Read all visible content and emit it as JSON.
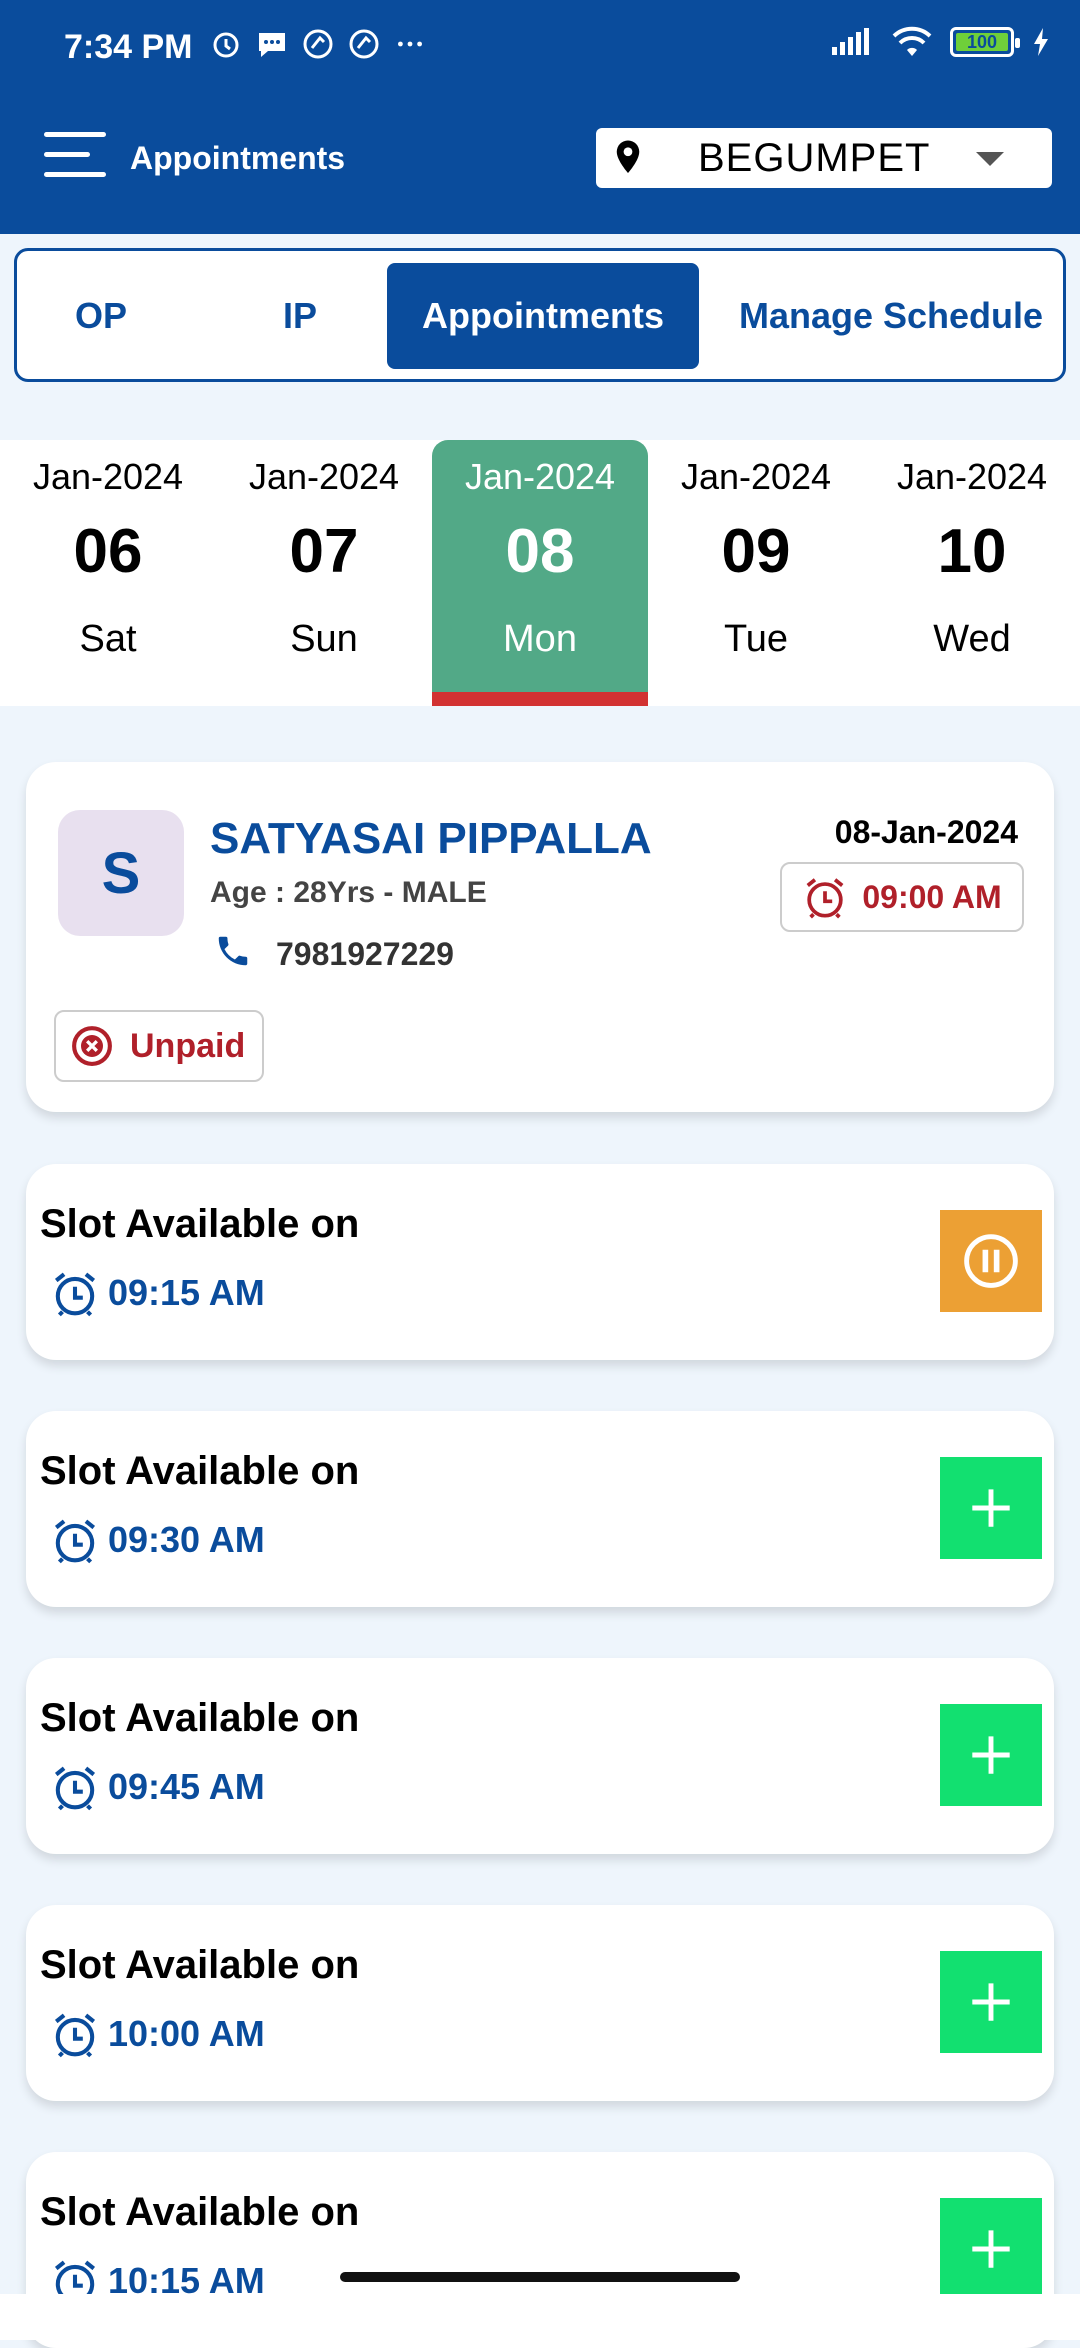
{
  "status_bar": {
    "time": "7:34 PM",
    "battery": "100"
  },
  "app_bar": {
    "title": "Appointments",
    "location": "BEGUMPET"
  },
  "tabs": [
    {
      "label": "OP"
    },
    {
      "label": "IP"
    },
    {
      "label": "Appointments",
      "active": true
    },
    {
      "label": "Manage Schedule"
    }
  ],
  "dates": [
    {
      "month": "Jan-2024",
      "day": "06",
      "weekday": "Sat"
    },
    {
      "month": "Jan-2024",
      "day": "07",
      "weekday": "Sun"
    },
    {
      "month": "Jan-2024",
      "day": "08",
      "weekday": "Mon",
      "active": true
    },
    {
      "month": "Jan-2024",
      "day": "09",
      "weekday": "Tue"
    },
    {
      "month": "Jan-2024",
      "day": "10",
      "weekday": "Wed"
    }
  ],
  "appointment": {
    "initial": "S",
    "name": "SATYASAI PIPPALLA",
    "age": "Age : 28Yrs - MALE",
    "phone": "7981927229",
    "date": "08-Jan-2024",
    "time": "09:00 AM",
    "payment_status": "Unpaid"
  },
  "slots": [
    {
      "label": "Slot Available on",
      "time": "09:15 AM",
      "action": "pause"
    },
    {
      "label": "Slot Available on",
      "time": "09:30 AM",
      "action": "add"
    },
    {
      "label": "Slot Available on",
      "time": "09:45 AM",
      "action": "add"
    },
    {
      "label": "Slot Available on",
      "time": "10:00 AM",
      "action": "add"
    },
    {
      "label": "Slot Available on",
      "time": "10:15 AM",
      "action": "add"
    }
  ],
  "colors": {
    "primary": "#0a4c9c",
    "active_date": "#52a987",
    "add_button": "#12e070",
    "pause_button": "#eca034",
    "alert_red": "#b0202a"
  }
}
